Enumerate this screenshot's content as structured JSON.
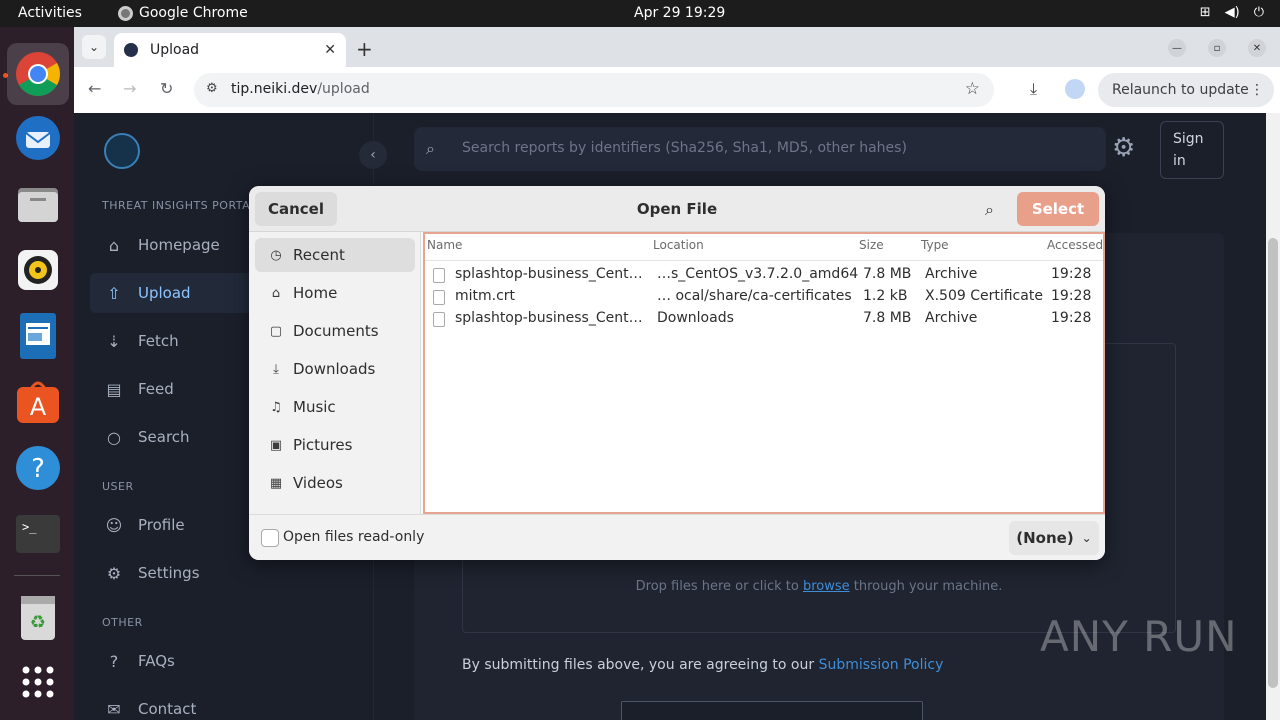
{
  "topbar": {
    "activities": "Activities",
    "app_name": "Google Chrome",
    "clock": "Apr 29  19:29"
  },
  "dock": {
    "items": [
      "chrome-icon",
      "thunderbird-icon",
      "files-icon",
      "rhythmbox-icon",
      "writer-icon",
      "appcenter-icon",
      "help-icon",
      "terminal-icon",
      "trash-icon",
      "app-grid-icon"
    ]
  },
  "browser": {
    "tab_title": "Upload",
    "url_host": "tip.neiki.dev",
    "url_path": "/upload",
    "relaunch_label": "Relaunch to update"
  },
  "sidebar": {
    "portal_label": "THREAT INSIGHTS PORTAL",
    "user_label": "USER",
    "other_label": "OTHER",
    "items": [
      {
        "label": "Homepage"
      },
      {
        "label": "Upload"
      },
      {
        "label": "Fetch"
      },
      {
        "label": "Feed"
      },
      {
        "label": "Search"
      },
      {
        "label": "Profile"
      },
      {
        "label": "Settings"
      },
      {
        "label": "FAQs"
      },
      {
        "label": "Contact"
      }
    ]
  },
  "main": {
    "search_placeholder": "Search reports by identifiers (Sha256, Sha1, MD5, other hahes)",
    "signin": "Sign in",
    "drop_prefix": "Drop files here or click to ",
    "drop_link": "browse",
    "drop_suffix": " through your machine.",
    "policy_prefix": "By submitting files above, you are agreeing to our ",
    "policy_link": "Submission Policy"
  },
  "dialog": {
    "title": "Open File",
    "cancel": "Cancel",
    "select": "Select",
    "places": [
      {
        "label": "Recent",
        "icon": "clock-icon"
      },
      {
        "label": "Home",
        "icon": "home-icon"
      },
      {
        "label": "Documents",
        "icon": "document-icon"
      },
      {
        "label": "Downloads",
        "icon": "download-icon"
      },
      {
        "label": "Music",
        "icon": "music-icon"
      },
      {
        "label": "Pictures",
        "icon": "picture-icon"
      },
      {
        "label": "Videos",
        "icon": "video-icon"
      }
    ],
    "columns": {
      "name": "Name",
      "location": "Location",
      "size": "Size",
      "type": "Type",
      "accessed": "Accessed"
    },
    "files": [
      {
        "name": "splashtop-business_Cent…",
        "location": "…s_CentOS_v3.7.2.0_amd64",
        "size": "7.8 MB",
        "type": "Archive",
        "accessed": "19:28"
      },
      {
        "name": "mitm.crt",
        "location": "… ocal/share/ca-certificates",
        "size": "1.2 kB",
        "type": "X.509 Certificate",
        "accessed": "19:28"
      },
      {
        "name": "splashtop-business_Cent…",
        "location": "Downloads",
        "size": "7.8 MB",
        "type": "Archive",
        "accessed": "19:28"
      }
    ],
    "readonly_label": "Open files read-only",
    "filter": "(None)"
  },
  "watermark": "ANY RUN",
  "colors": {
    "accent": "#e9a08b",
    "link": "#3f8ed8",
    "active_nav": "#8ec5ff"
  }
}
